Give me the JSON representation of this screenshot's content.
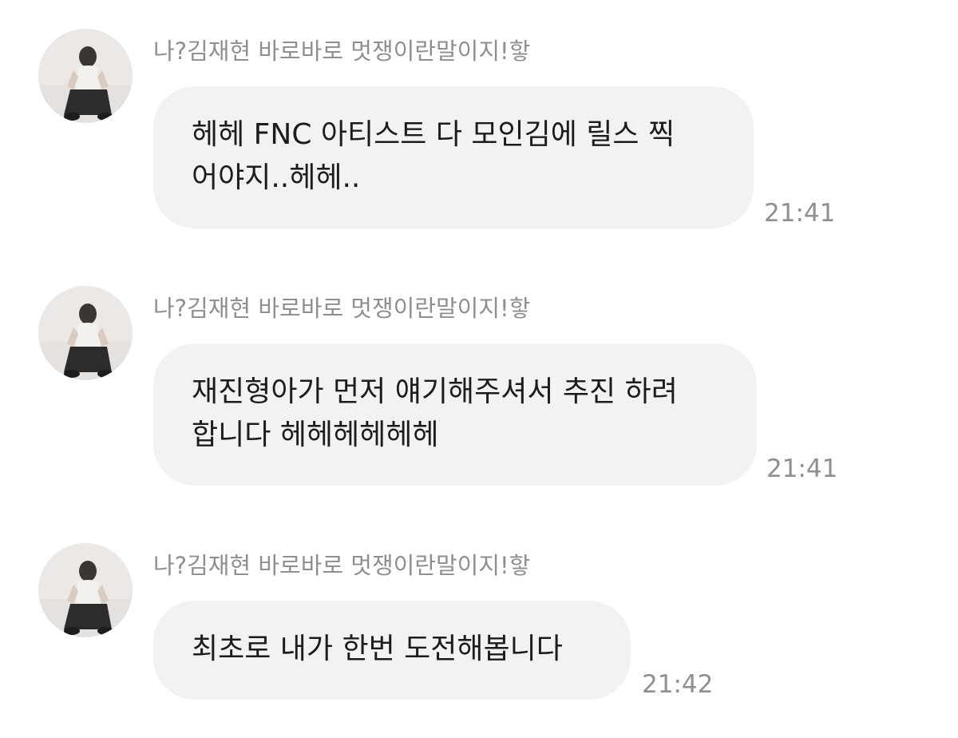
{
  "messages": [
    {
      "sender": "나?김재현 바로바로 멋쟁이란말이지!핳",
      "lines": [
        "헤헤 FNC 아티스트 다 모인김에 릴스 찍",
        "어야지..헤헤.."
      ],
      "time": "21:41"
    },
    {
      "sender": "나?김재현 바로바로 멋쟁이란말이지!핳",
      "lines": [
        "재진형아가 먼저 얘기해주셔서 추진 하려",
        "합니다 헤헤헤헤헤헤"
      ],
      "time": "21:41"
    },
    {
      "sender": "나?김재현 바로바로 멋쟁이란말이지!핳",
      "lines": [
        "최초로 내가 한번 도전해봅니다"
      ],
      "time": "21:42"
    }
  ],
  "colors": {
    "bubble": "#f2f2f4",
    "meta_text": "#8e8e93",
    "message_text": "#1c1c1e"
  }
}
